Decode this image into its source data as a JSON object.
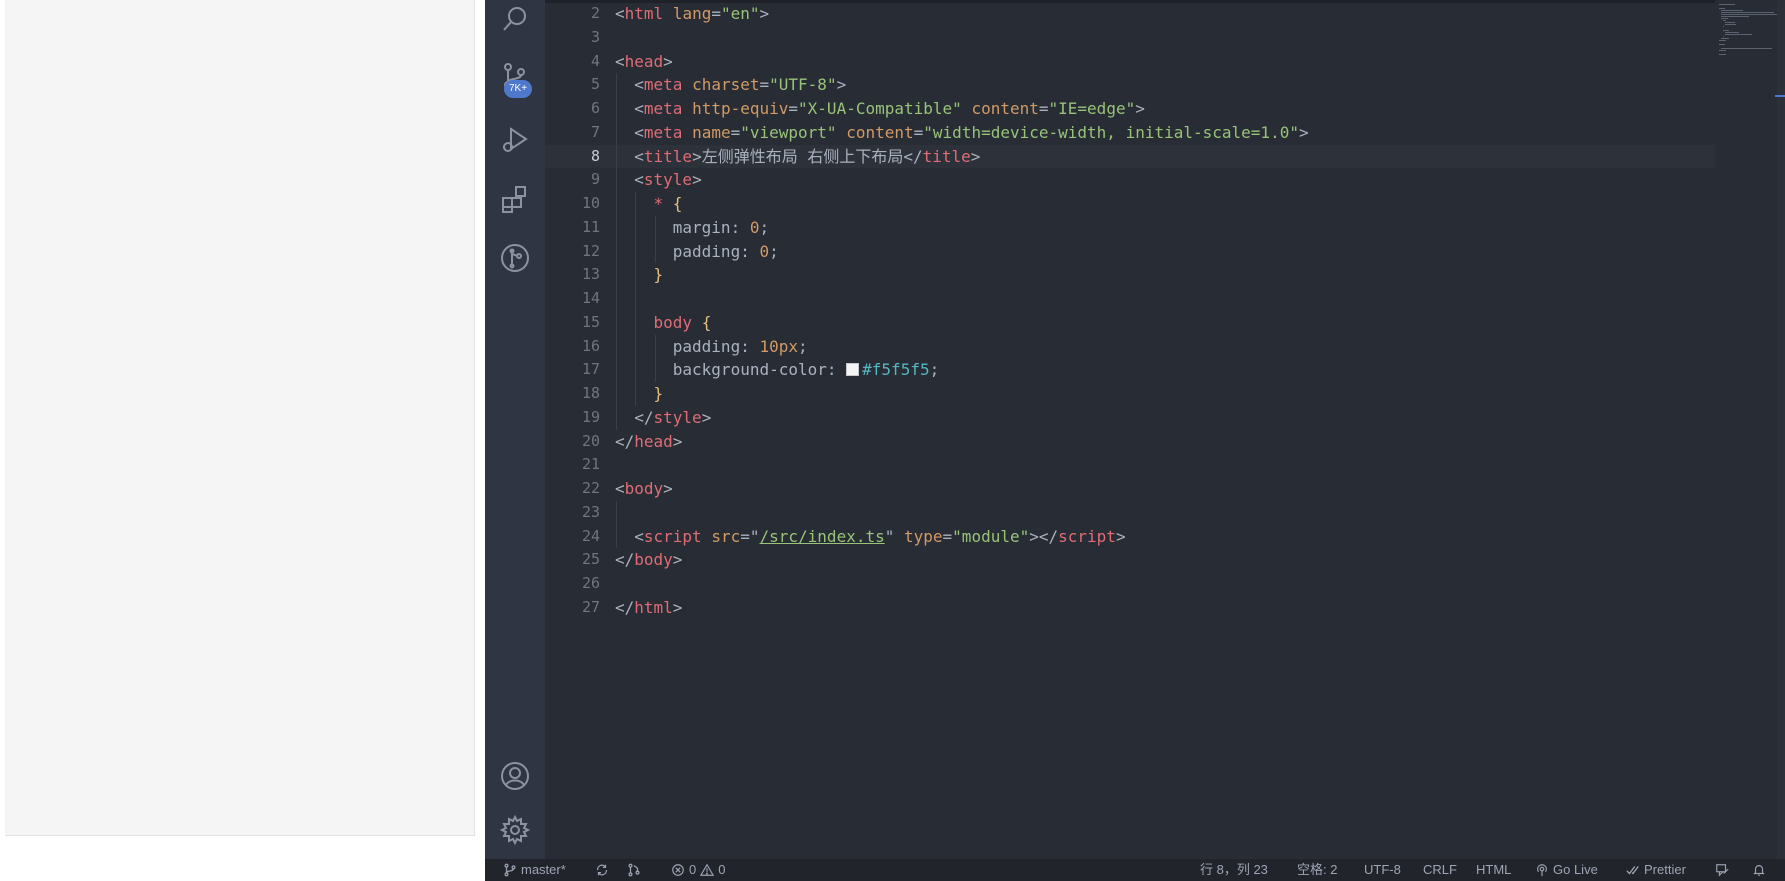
{
  "editor": {
    "lines": [
      {
        "n": "2",
        "indent": 0,
        "tokens": [
          [
            "punc",
            "<"
          ],
          [
            "tag",
            "html"
          ],
          [
            "punc",
            " "
          ],
          [
            "attr",
            "lang"
          ],
          [
            "punc",
            "="
          ],
          [
            "str",
            "\"en\""
          ],
          [
            "punc",
            ">"
          ]
        ]
      },
      {
        "n": "3",
        "indent": 0,
        "tokens": []
      },
      {
        "n": "4",
        "indent": 0,
        "tokens": [
          [
            "punc",
            "<"
          ],
          [
            "tag",
            "head"
          ],
          [
            "punc",
            ">"
          ]
        ]
      },
      {
        "n": "5",
        "indent": 1,
        "tokens": [
          [
            "punc",
            "<"
          ],
          [
            "tag",
            "meta"
          ],
          [
            "punc",
            " "
          ],
          [
            "attr",
            "charset"
          ],
          [
            "punc",
            "="
          ],
          [
            "str",
            "\"UTF-8\""
          ],
          [
            "punc",
            ">"
          ]
        ]
      },
      {
        "n": "6",
        "indent": 1,
        "tokens": [
          [
            "punc",
            "<"
          ],
          [
            "tag",
            "meta"
          ],
          [
            "punc",
            " "
          ],
          [
            "attr",
            "http-equiv"
          ],
          [
            "punc",
            "="
          ],
          [
            "str",
            "\"X-UA-Compatible\""
          ],
          [
            "punc",
            " "
          ],
          [
            "attr",
            "content"
          ],
          [
            "punc",
            "="
          ],
          [
            "str",
            "\"IE=edge\""
          ],
          [
            "punc",
            ">"
          ]
        ]
      },
      {
        "n": "7",
        "indent": 1,
        "tokens": [
          [
            "punc",
            "<"
          ],
          [
            "tag",
            "meta"
          ],
          [
            "punc",
            " "
          ],
          [
            "attr",
            "name"
          ],
          [
            "punc",
            "="
          ],
          [
            "str",
            "\"viewport\""
          ],
          [
            "punc",
            " "
          ],
          [
            "attr",
            "content"
          ],
          [
            "punc",
            "="
          ],
          [
            "str",
            "\"width=device-width, initial-scale=1.0\""
          ],
          [
            "punc",
            ">"
          ]
        ]
      },
      {
        "n": "8",
        "indent": 1,
        "tokens": [
          [
            "punc",
            "<"
          ],
          [
            "tag",
            "title"
          ],
          [
            "punc",
            ">左侧弹性布局 右侧上下布局</"
          ],
          [
            "tag",
            "title"
          ],
          [
            "punc",
            ">"
          ]
        ]
      },
      {
        "n": "9",
        "indent": 1,
        "tokens": [
          [
            "punc",
            "<"
          ],
          [
            "tag",
            "style"
          ],
          [
            "punc",
            ">"
          ]
        ]
      },
      {
        "n": "10",
        "indent": 2,
        "tokens": [
          [
            "sel",
            "*"
          ],
          [
            "punc",
            " "
          ],
          [
            "brace",
            "{"
          ]
        ]
      },
      {
        "n": "11",
        "indent": 3,
        "tokens": [
          [
            "prop",
            "margin"
          ],
          [
            "punc",
            ": "
          ],
          [
            "num",
            "0"
          ],
          [
            "punc",
            ";"
          ]
        ]
      },
      {
        "n": "12",
        "indent": 3,
        "tokens": [
          [
            "prop",
            "padding"
          ],
          [
            "punc",
            ": "
          ],
          [
            "num",
            "0"
          ],
          [
            "punc",
            ";"
          ]
        ]
      },
      {
        "n": "13",
        "indent": 2,
        "tokens": [
          [
            "brace",
            "}"
          ]
        ]
      },
      {
        "n": "14",
        "indent": 2,
        "tokens": []
      },
      {
        "n": "15",
        "indent": 2,
        "tokens": [
          [
            "sel",
            "body"
          ],
          [
            "punc",
            " "
          ],
          [
            "brace",
            "{"
          ]
        ]
      },
      {
        "n": "16",
        "indent": 3,
        "tokens": [
          [
            "prop",
            "padding"
          ],
          [
            "punc",
            ": "
          ],
          [
            "num",
            "10px"
          ],
          [
            "punc",
            ";"
          ]
        ]
      },
      {
        "n": "17",
        "indent": 3,
        "tokens": [
          [
            "prop",
            "background-color"
          ],
          [
            "punc",
            ": "
          ],
          [
            "swatch",
            ""
          ],
          [
            "color",
            "#f5f5f5"
          ],
          [
            "punc",
            ";"
          ]
        ]
      },
      {
        "n": "18",
        "indent": 2,
        "tokens": [
          [
            "brace",
            "}"
          ]
        ]
      },
      {
        "n": "19",
        "indent": 1,
        "tokens": [
          [
            "punc",
            "</"
          ],
          [
            "tag",
            "style"
          ],
          [
            "punc",
            ">"
          ]
        ]
      },
      {
        "n": "20",
        "indent": 0,
        "tokens": [
          [
            "punc",
            "</"
          ],
          [
            "tag",
            "head"
          ],
          [
            "punc",
            ">"
          ]
        ]
      },
      {
        "n": "21",
        "indent": 0,
        "tokens": []
      },
      {
        "n": "22",
        "indent": 0,
        "tokens": [
          [
            "punc",
            "<"
          ],
          [
            "tag",
            "body"
          ],
          [
            "punc",
            ">"
          ]
        ]
      },
      {
        "n": "23",
        "indent": 1,
        "tokens": []
      },
      {
        "n": "24",
        "indent": 1,
        "tokens": [
          [
            "punc",
            "<"
          ],
          [
            "tag",
            "script"
          ],
          [
            "punc",
            " "
          ],
          [
            "attr",
            "src"
          ],
          [
            "punc",
            "=\""
          ],
          [
            "link",
            "/src/index.ts"
          ],
          [
            "punc",
            "\" "
          ],
          [
            "attr",
            "type"
          ],
          [
            "punc",
            "="
          ],
          [
            "str",
            "\"module\""
          ],
          [
            "punc",
            "></"
          ],
          [
            "tag",
            "script"
          ],
          [
            "punc",
            ">"
          ]
        ]
      },
      {
        "n": "25",
        "indent": 0,
        "tokens": [
          [
            "punc",
            "</"
          ],
          [
            "tag",
            "body"
          ],
          [
            "punc",
            ">"
          ]
        ]
      },
      {
        "n": "26",
        "indent": 0,
        "tokens": []
      },
      {
        "n": "27",
        "indent": 0,
        "tokens": [
          [
            "punc",
            "</"
          ],
          [
            "tag",
            "html"
          ],
          [
            "punc",
            ">"
          ]
        ]
      }
    ],
    "current_line": "8"
  },
  "activity_bar": {
    "icons": [
      "search-icon",
      "source-control-icon",
      "run-debug-icon",
      "extensions-icon",
      "git-graph-icon",
      "account-icon",
      "settings-gear-icon"
    ],
    "scm_badge": "7K+"
  },
  "status_bar": {
    "branch": "master*",
    "errors": "0",
    "warnings": "0",
    "cursor": "行 8，列 23",
    "indent": "空格: 2",
    "encoding": "UTF-8",
    "eol": "CRLF",
    "language": "HTML",
    "go_live": "Go Live",
    "prettier": "Prettier"
  },
  "colors": {
    "editor_bg": "#282c34",
    "activity_bg": "#2f3542",
    "statusbar_bg": "#21252b",
    "accent": "#4d78cc",
    "tag": "#e06c75",
    "attribute": "#d19a66",
    "string": "#98c379",
    "brace": "#e5c07b",
    "preview_bg": "#f5f5f5"
  }
}
